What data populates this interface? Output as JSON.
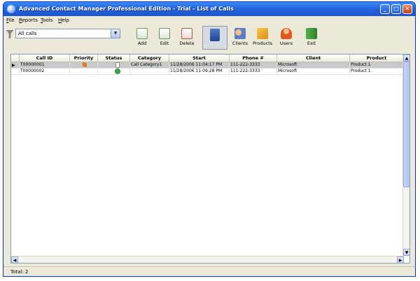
{
  "window": {
    "title": "Advanced Contact Manager Professional Edition - Trial - List of Calls"
  },
  "menu": [
    "File",
    "Reports",
    "Tools",
    "Help"
  ],
  "filter": {
    "selected": "All calls"
  },
  "toolbar": {
    "buttons": [
      "Add",
      "Edit",
      "Delete",
      "",
      "Clients",
      "Products",
      "Users",
      "Exit"
    ]
  },
  "table": {
    "columns": [
      "Call ID",
      "Priority",
      "Status",
      "Category",
      "Start",
      "Phone #",
      "Client",
      "Product"
    ],
    "rows": [
      {
        "call_id": "T00000001",
        "category": "Call Category1",
        "start": "11/28/2006 11:04:17 PM",
        "phone": "111-222-3333",
        "client": "Microsoft",
        "product": "Product 1"
      },
      {
        "call_id": "T00000002",
        "category": "",
        "start": "11/28/2006 11:09:28 PM",
        "phone": "111-222-3333",
        "client": "Microsoft",
        "product": "Product 1"
      }
    ]
  },
  "statusbar": {
    "total": "Total: 2"
  },
  "colors": {
    "title_bar": "#2465dd",
    "selected_row": "#c8c8c8"
  }
}
